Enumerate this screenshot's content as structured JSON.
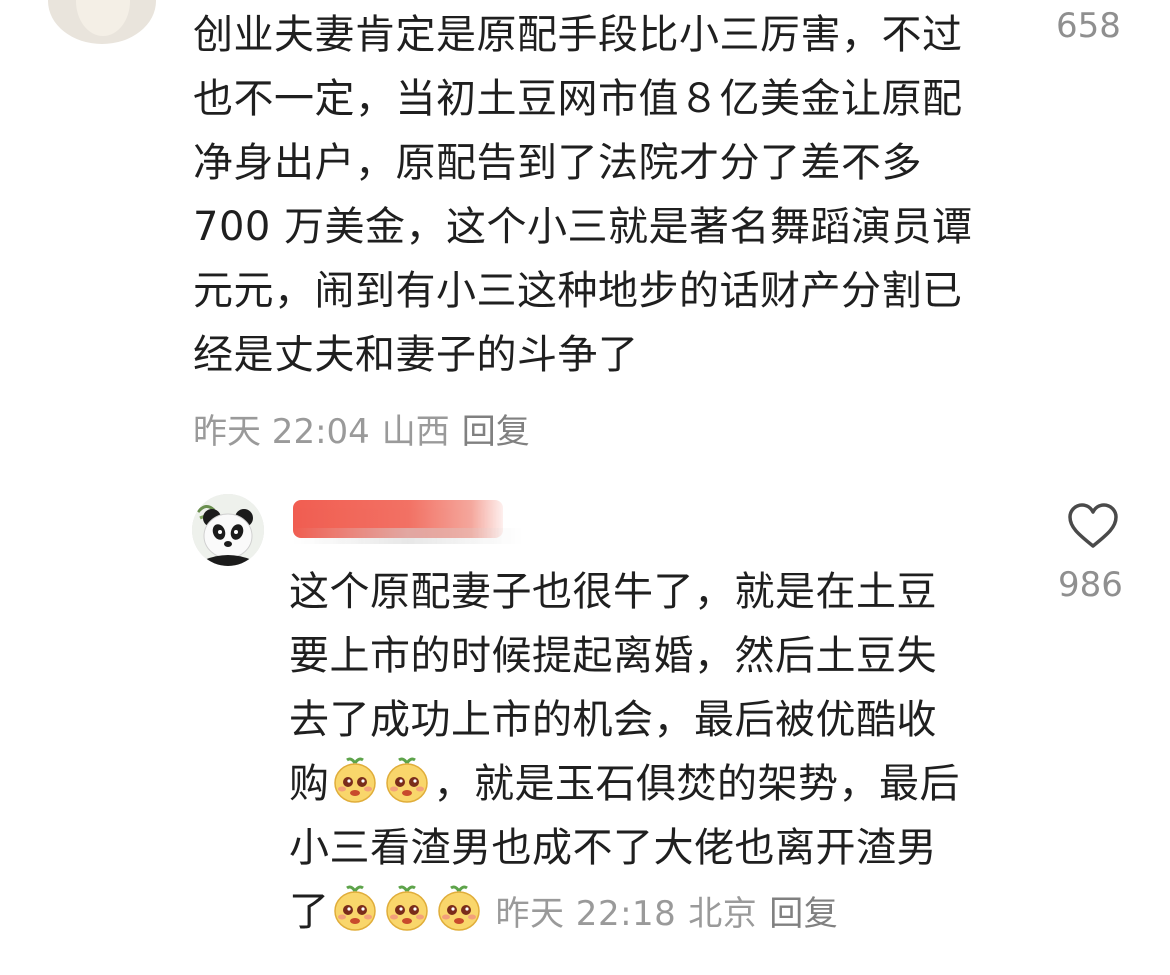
{
  "comment1": {
    "lines": [
      "创业夫妻肯定是原配手段比小三厉害，不过",
      "也不一定，当初土豆网市值８亿美金让原配",
      "净身出户，原配告到了法院才分了差不多",
      "700 万美金，这个小三就是著名舞蹈演员谭",
      "元元，闹到有小三这种地步的话财产分割已",
      "经是丈夫和妻子的斗争了"
    ],
    "likes": "658",
    "time": "昨天 22:04",
    "location": "山西",
    "reply_label": "回复"
  },
  "comment2": {
    "username_redacted": true,
    "lines": [
      "这个原配妻子也很牛了，就是在土豆",
      "要上市的时候提起离婚，然后土豆失",
      "去了成功上市的机会，最后被优酷收",
      "购",
      "，就是玉石俱焚的架势，最后",
      "小三看渣男也成不了大佬也离开渣男",
      "了"
    ],
    "likes": "986",
    "time": "昨天 22:18",
    "location": "北京",
    "reply_label": "回复",
    "emoji_icon": "cute-face-emoji"
  },
  "colors": {
    "meta_text": "#9a9a9a",
    "redaction": "#f05548"
  }
}
